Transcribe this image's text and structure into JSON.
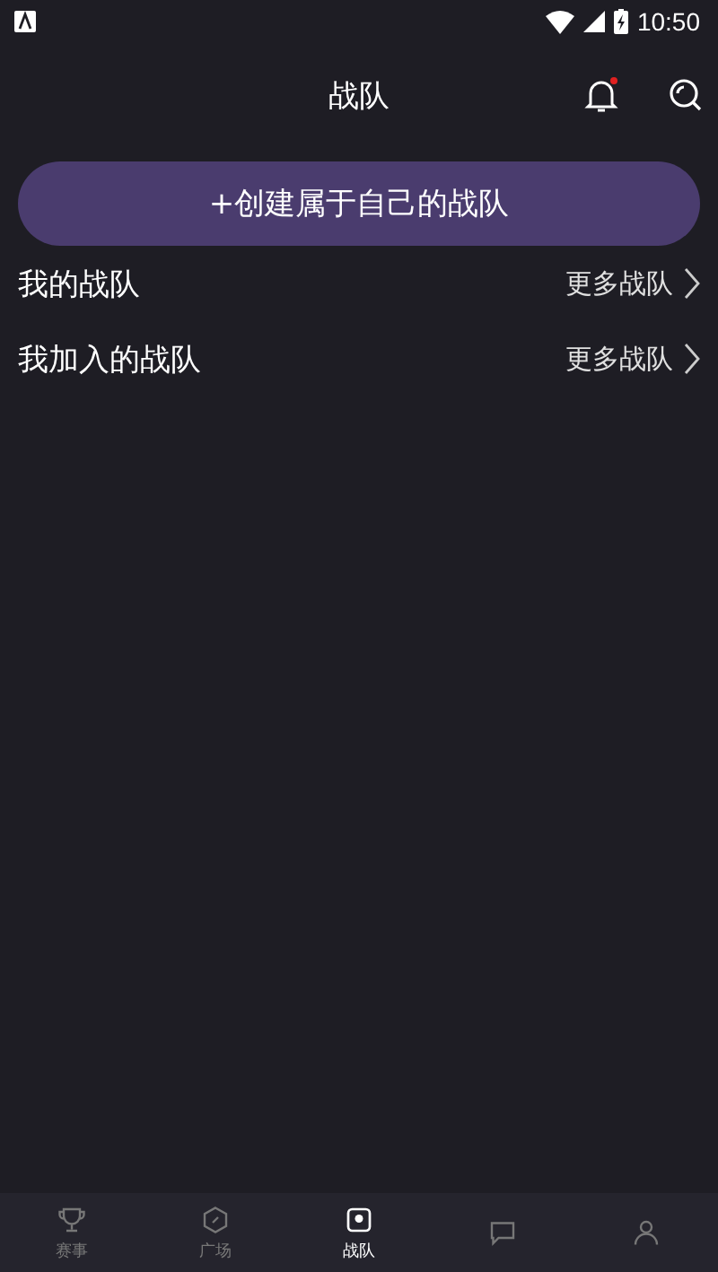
{
  "status_bar": {
    "time": "10:50"
  },
  "header": {
    "title": "战队",
    "notification_dot": true
  },
  "create_button": {
    "label": "+创建属于自己的战队"
  },
  "sections": [
    {
      "title": "我的战队",
      "more": "更多战队"
    },
    {
      "title": "我加入的战队",
      "more": "更多战队"
    }
  ],
  "bottom_nav": [
    {
      "kind": "trophy",
      "label": "赛事",
      "selected": false
    },
    {
      "kind": "hexagon",
      "label": "广场",
      "selected": false
    },
    {
      "kind": "team",
      "label": "战队",
      "selected": true
    },
    {
      "kind": "chat",
      "selected": false
    },
    {
      "kind": "person",
      "selected": false
    }
  ]
}
